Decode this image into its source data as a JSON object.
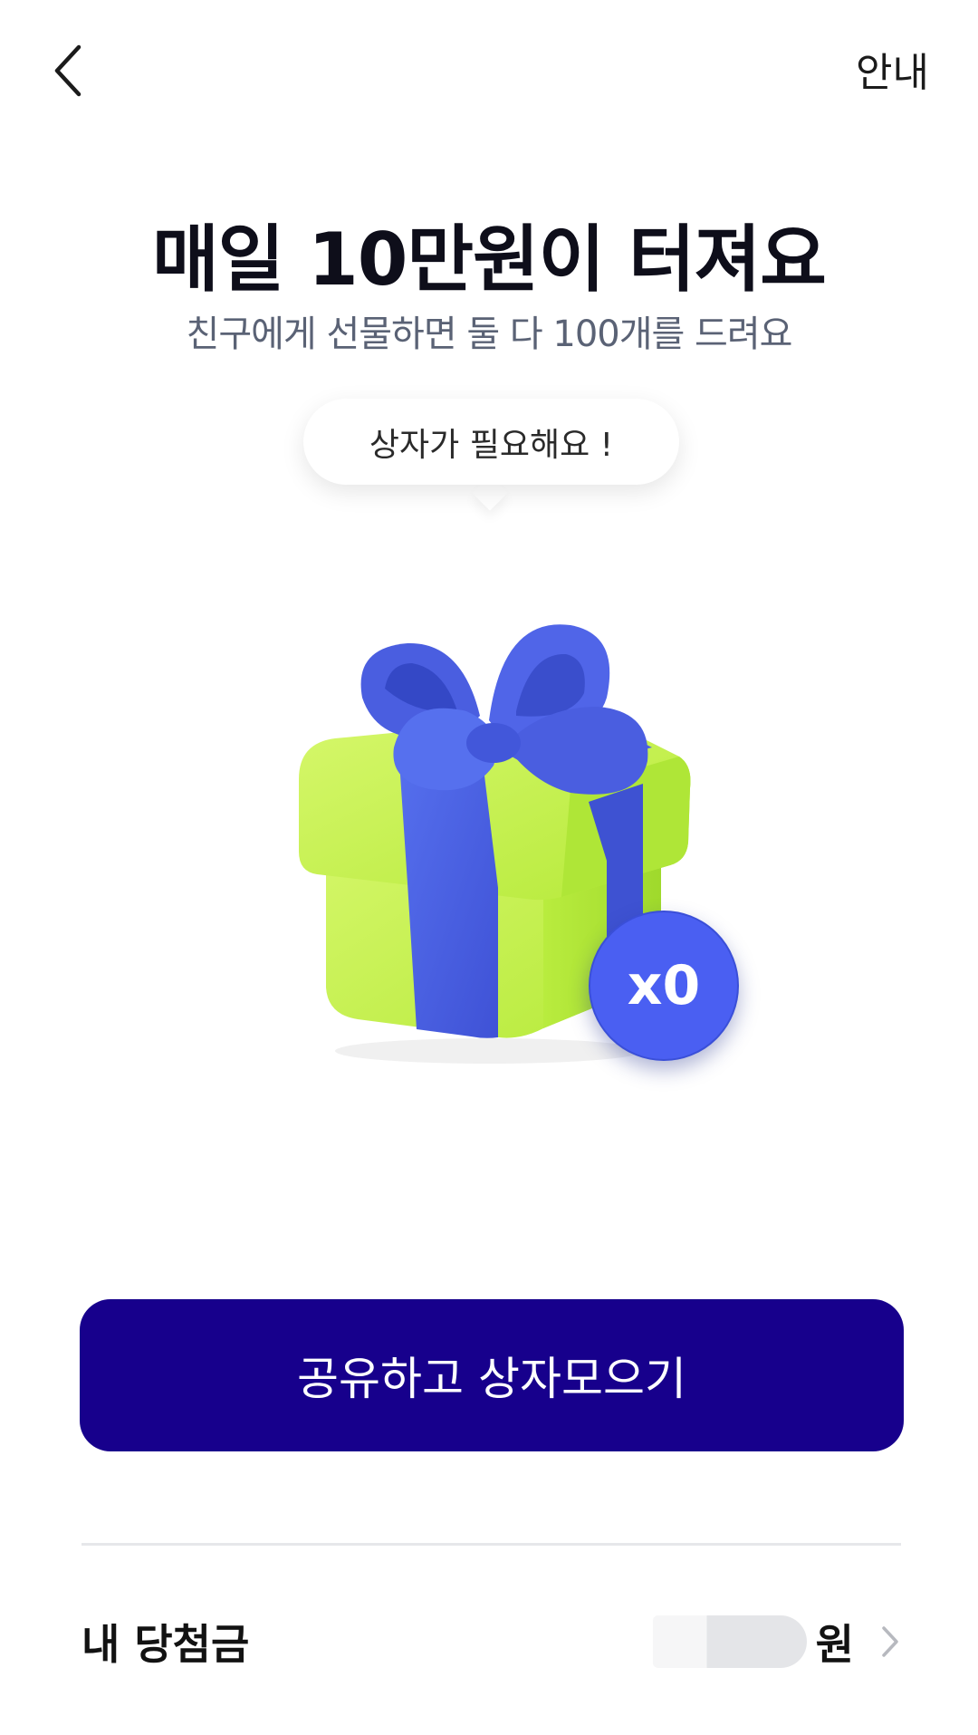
{
  "header": {
    "back_icon": "chevron-left-icon",
    "info_label": "안내"
  },
  "hero": {
    "title": "매일 10만원이 터져요",
    "subtitle": "친구에게 선물하면 둘 다 100개를 드려요",
    "bubble_text": "상자가 필요해요 !",
    "gift_icon": "gift-box-icon",
    "box_count_label": "x0",
    "colors": {
      "box": "#c2f04a",
      "ribbon": "#4a5ee0",
      "badge": "#4a5ff2"
    }
  },
  "cta": {
    "label": "공유하고 상자모으기",
    "color": "#17008c"
  },
  "winnings": {
    "label": "내 당첨금",
    "currency": "원",
    "chevron_icon": "chevron-right-icon"
  }
}
